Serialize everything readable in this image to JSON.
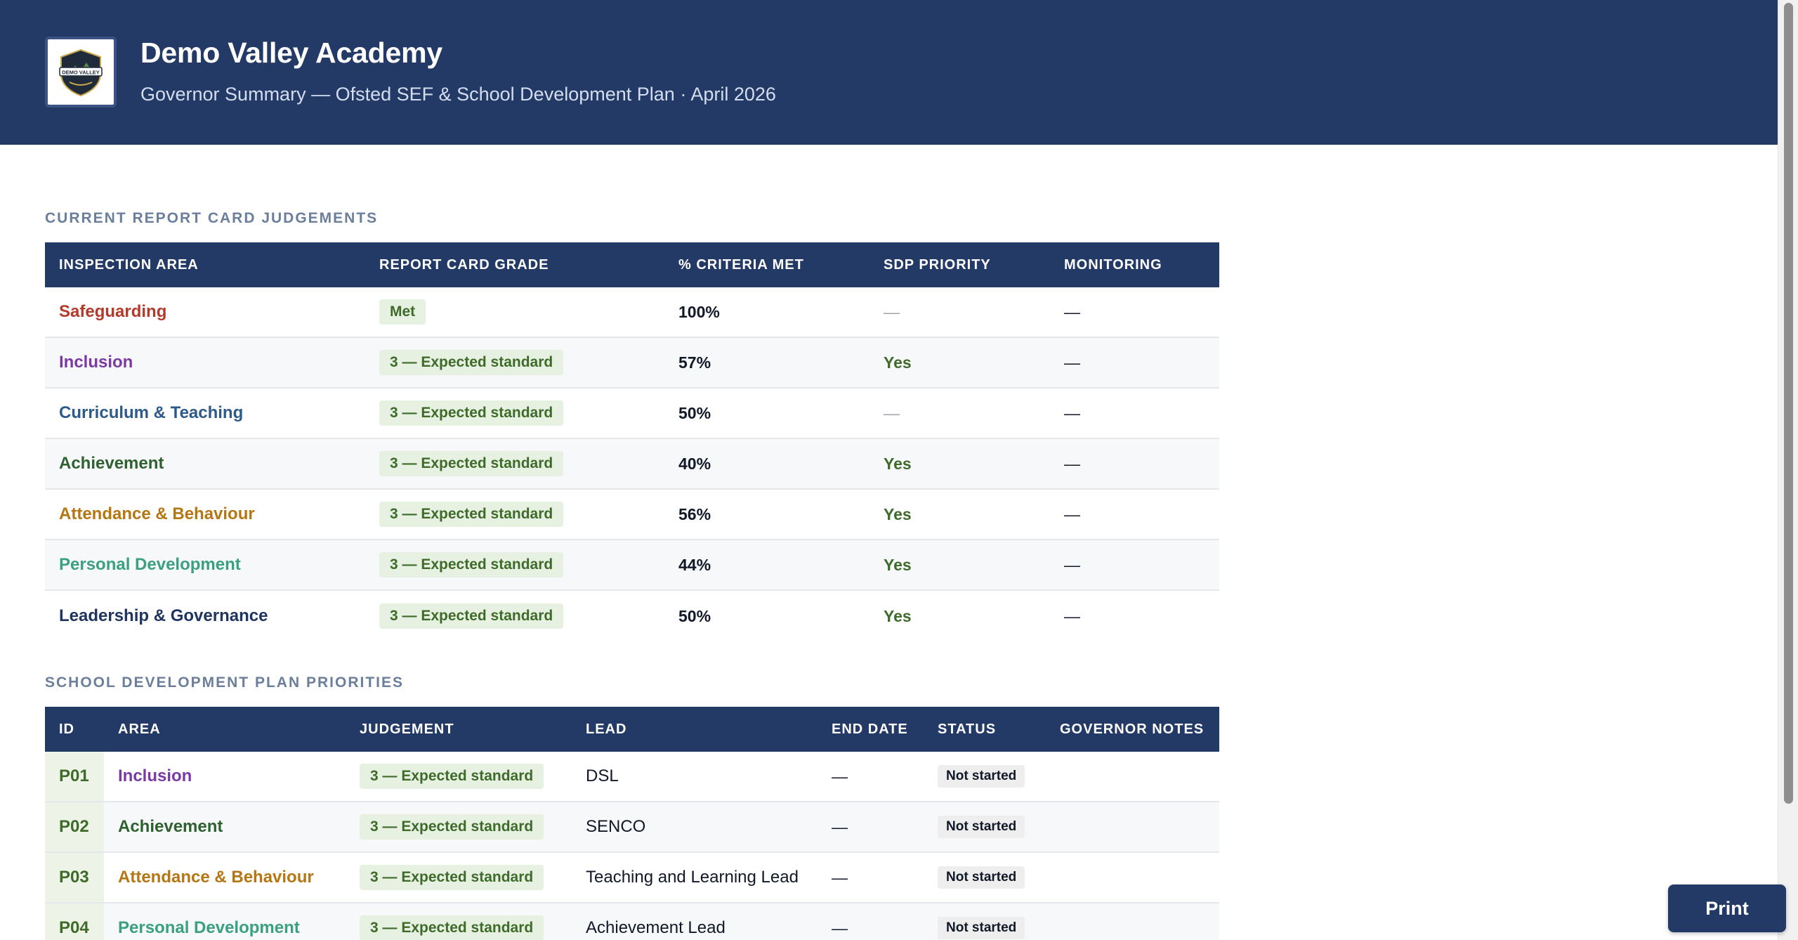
{
  "header": {
    "title": "Demo Valley Academy",
    "subtitle": "Governor Summary — Ofsted SEF & School Development Plan · April 2026",
    "logo_text": "DEMO VALLEY"
  },
  "judgements": {
    "section_title": "CURRENT REPORT CARD JUDGEMENTS",
    "columns": [
      "INSPECTION AREA",
      "REPORT CARD GRADE",
      "% CRITERIA MET",
      "SDP PRIORITY",
      "MONITORING"
    ],
    "rows": [
      {
        "area": "Safeguarding",
        "color": "#b33a2a",
        "grade": "Met",
        "pct": "100%",
        "priority": "—",
        "monitoring": "—"
      },
      {
        "area": "Inclusion",
        "color": "#7b3aa3",
        "grade": "3 — Expected standard",
        "pct": "57%",
        "priority": "Yes",
        "monitoring": "—"
      },
      {
        "area": "Curriculum & Teaching",
        "color": "#2c5a8a",
        "grade": "3 — Expected standard",
        "pct": "50%",
        "priority": "—",
        "monitoring": "—"
      },
      {
        "area": "Achievement",
        "color": "#2e6030",
        "grade": "3 — Expected standard",
        "pct": "40%",
        "priority": "Yes",
        "monitoring": "—"
      },
      {
        "area": "Attendance & Behaviour",
        "color": "#b57614",
        "grade": "3 — Expected standard",
        "pct": "56%",
        "priority": "Yes",
        "monitoring": "—"
      },
      {
        "area": "Personal Development",
        "color": "#3aa07e",
        "grade": "3 — Expected standard",
        "pct": "44%",
        "priority": "Yes",
        "monitoring": "—"
      },
      {
        "area": "Leadership & Governance",
        "color": "#1f3460",
        "grade": "3 — Expected standard",
        "pct": "50%",
        "priority": "Yes",
        "monitoring": "—"
      }
    ]
  },
  "sdp": {
    "section_title": "SCHOOL DEVELOPMENT PLAN PRIORITIES",
    "columns": [
      "ID",
      "AREA",
      "JUDGEMENT",
      "LEAD",
      "END DATE",
      "STATUS",
      "GOVERNOR NOTES"
    ],
    "rows": [
      {
        "id": "P01",
        "area": "Inclusion",
        "color": "#7b3aa3",
        "judgement": "3 — Expected standard",
        "lead": "DSL",
        "end_date": "—",
        "status": "Not started",
        "notes": ""
      },
      {
        "id": "P02",
        "area": "Achievement",
        "color": "#2e6030",
        "judgement": "3 — Expected standard",
        "lead": "SENCO",
        "end_date": "—",
        "status": "Not started",
        "notes": ""
      },
      {
        "id": "P03",
        "area": "Attendance & Behaviour",
        "color": "#b57614",
        "judgement": "3 — Expected standard",
        "lead": "Teaching and Learning Lead",
        "end_date": "—",
        "status": "Not started",
        "notes": ""
      },
      {
        "id": "P04",
        "area": "Personal Development",
        "color": "#3aa07e",
        "judgement": "3 — Expected standard",
        "lead": "Achievement Lead",
        "end_date": "—",
        "status": "Not started",
        "notes": ""
      }
    ]
  },
  "actions": {
    "print_label": "Print"
  },
  "colors": {
    "brand": "#243a66",
    "badge_bg": "#e6f1e1",
    "badge_text": "#3f6b2a"
  }
}
